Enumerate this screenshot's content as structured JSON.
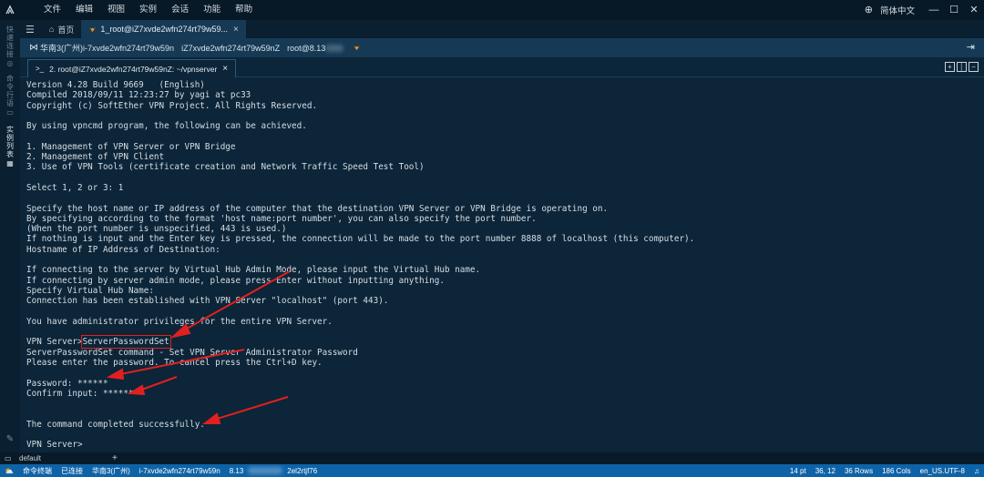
{
  "titlebar": {
    "menu": [
      "文件",
      "编辑",
      "视图",
      "实例",
      "会话",
      "功能",
      "帮助"
    ],
    "language": "简体中文"
  },
  "activitybar": {
    "items": [
      {
        "label": "快速连接",
        "sym": "◎"
      },
      {
        "label": "命令行语",
        "sym": "▭"
      },
      {
        "label": "实例列表",
        "sym": "▦"
      }
    ]
  },
  "tabs": {
    "home": "首页",
    "session": "1_root@iZ7xvde2wfn274rt79w59..."
  },
  "session_bar": {
    "region": "华南3(广州)i-7xvde2wfn274rt79w59n",
    "host": "iZ7xvde2wfn274rt79w59nZ",
    "user": "root@8.13"
  },
  "terminal_tab": {
    "label": "2. root@iZ7xvde2wfn274rt79w59nZ: ~/vpnserver"
  },
  "terminal": {
    "lines": [
      "Version 4.28 Build 9669   (English)",
      "Compiled 2018/09/11 12:23:27 by yagi at pc33",
      "Copyright (c) SoftEther VPN Project. All Rights Reserved.",
      "",
      "By using vpncmd program, the following can be achieved.",
      "",
      "1. Management of VPN Server or VPN Bridge",
      "2. Management of VPN Client",
      "3. Use of VPN Tools (certificate creation and Network Traffic Speed Test Tool)",
      "",
      "Select 1, 2 or 3: 1",
      "",
      "Specify the host name or IP address of the computer that the destination VPN Server or VPN Bridge is operating on.",
      "By specifying according to the format 'host name:port number', you can also specify the port number.",
      "(When the port number is unspecified, 443 is used.)",
      "If nothing is input and the Enter key is pressed, the connection will be made to the port number 8888 of localhost (this computer).",
      "Hostname of IP Address of Destination:",
      "",
      "If connecting to the server by Virtual Hub Admin Mode, please input the Virtual Hub name.",
      "If connecting by server admin mode, please press Enter without inputting anything.",
      "Specify Virtual Hub Name:",
      "Connection has been established with VPN Server \"localhost\" (port 443).",
      "",
      "You have administrator privileges for the entire VPN Server.",
      "",
      "",
      "ServerPasswordSet command - Set VPN Server Administrator Password",
      "Please enter the password. To cancel press the Ctrl+D key.",
      "",
      "Password: ******",
      "Confirm input: ******",
      "",
      "",
      "The command completed successfully.",
      "",
      "VPN Server>"
    ],
    "prompt": "VPN Server>",
    "highlighted_command": "ServerPasswordSet"
  },
  "panel": {
    "name": "default"
  },
  "statusbar": {
    "left": [
      "命令终端",
      "已连接",
      "华南3(广州)",
      "i-7xvde2wfn274rt79w59n",
      "8.13",
      "2el2rtjf76"
    ],
    "right": [
      "14 pt",
      "36, 12",
      "36 Rows",
      "186 Cols",
      "en_US.UTF-8"
    ]
  },
  "colors": {
    "background": "#0c2538",
    "statusbar": "#0e63a8",
    "annotation": "#e02020"
  }
}
